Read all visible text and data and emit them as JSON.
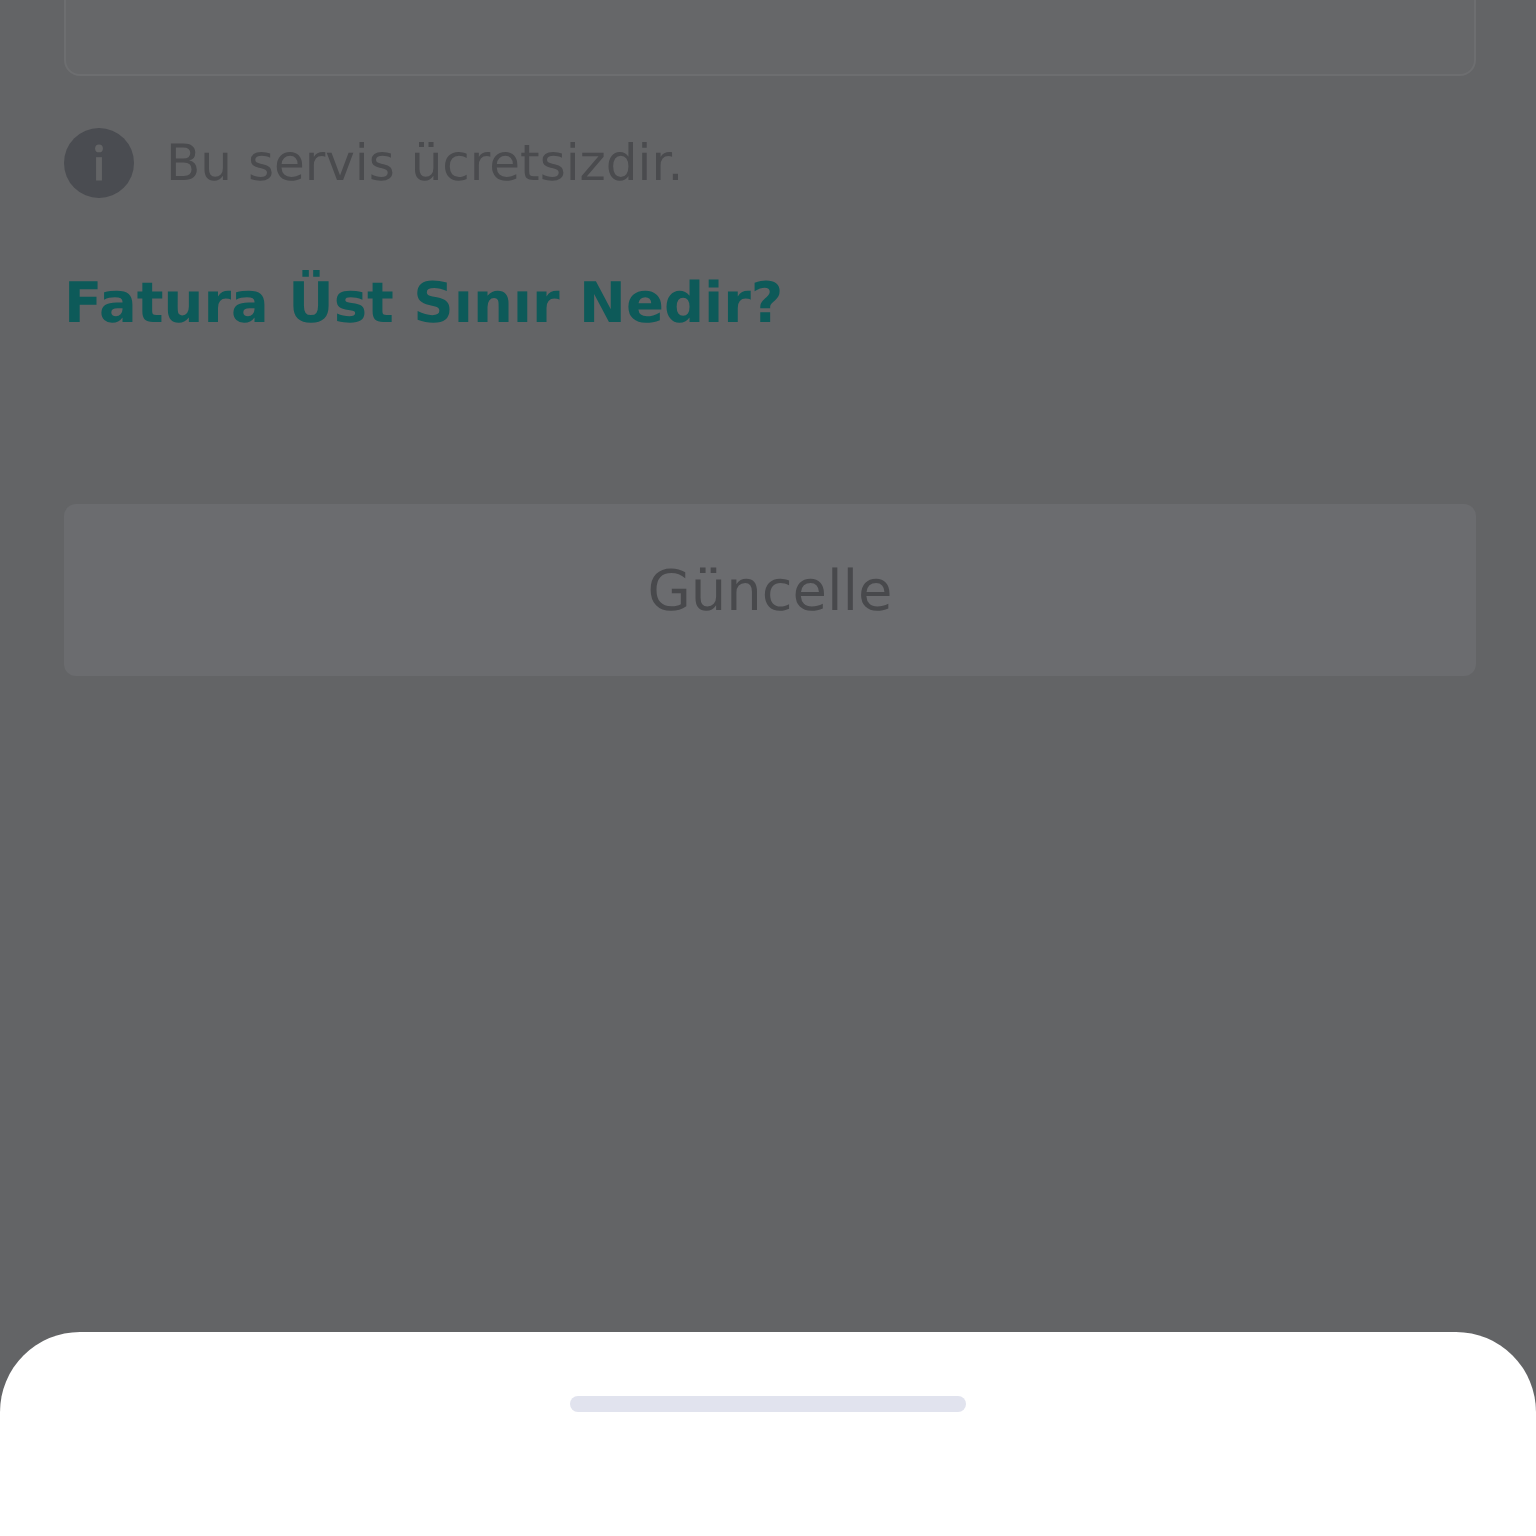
{
  "info": {
    "text": "Bu servis ücretsizdir."
  },
  "link": {
    "label": "Fatura Üst Sınır Nedir?"
  },
  "button": {
    "label": "Güncelle"
  }
}
